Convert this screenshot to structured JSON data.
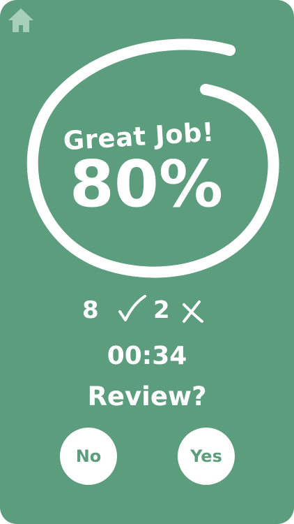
{
  "colors": {
    "background": "#5b9d7d",
    "foreground": "#ffffff",
    "home_icon": "#a7d0b9",
    "button_text": "#5b9d7d"
  },
  "nav": {
    "home_icon": "home-icon"
  },
  "result": {
    "headline": "Great Job!",
    "percent": "80%"
  },
  "tally": {
    "correct": "8",
    "correct_icon": "check-icon",
    "wrong": "2",
    "wrong_icon": "cross-icon"
  },
  "timer": "00:34",
  "review": {
    "prompt": "Review?",
    "no_label": "No",
    "yes_label": "Yes"
  }
}
